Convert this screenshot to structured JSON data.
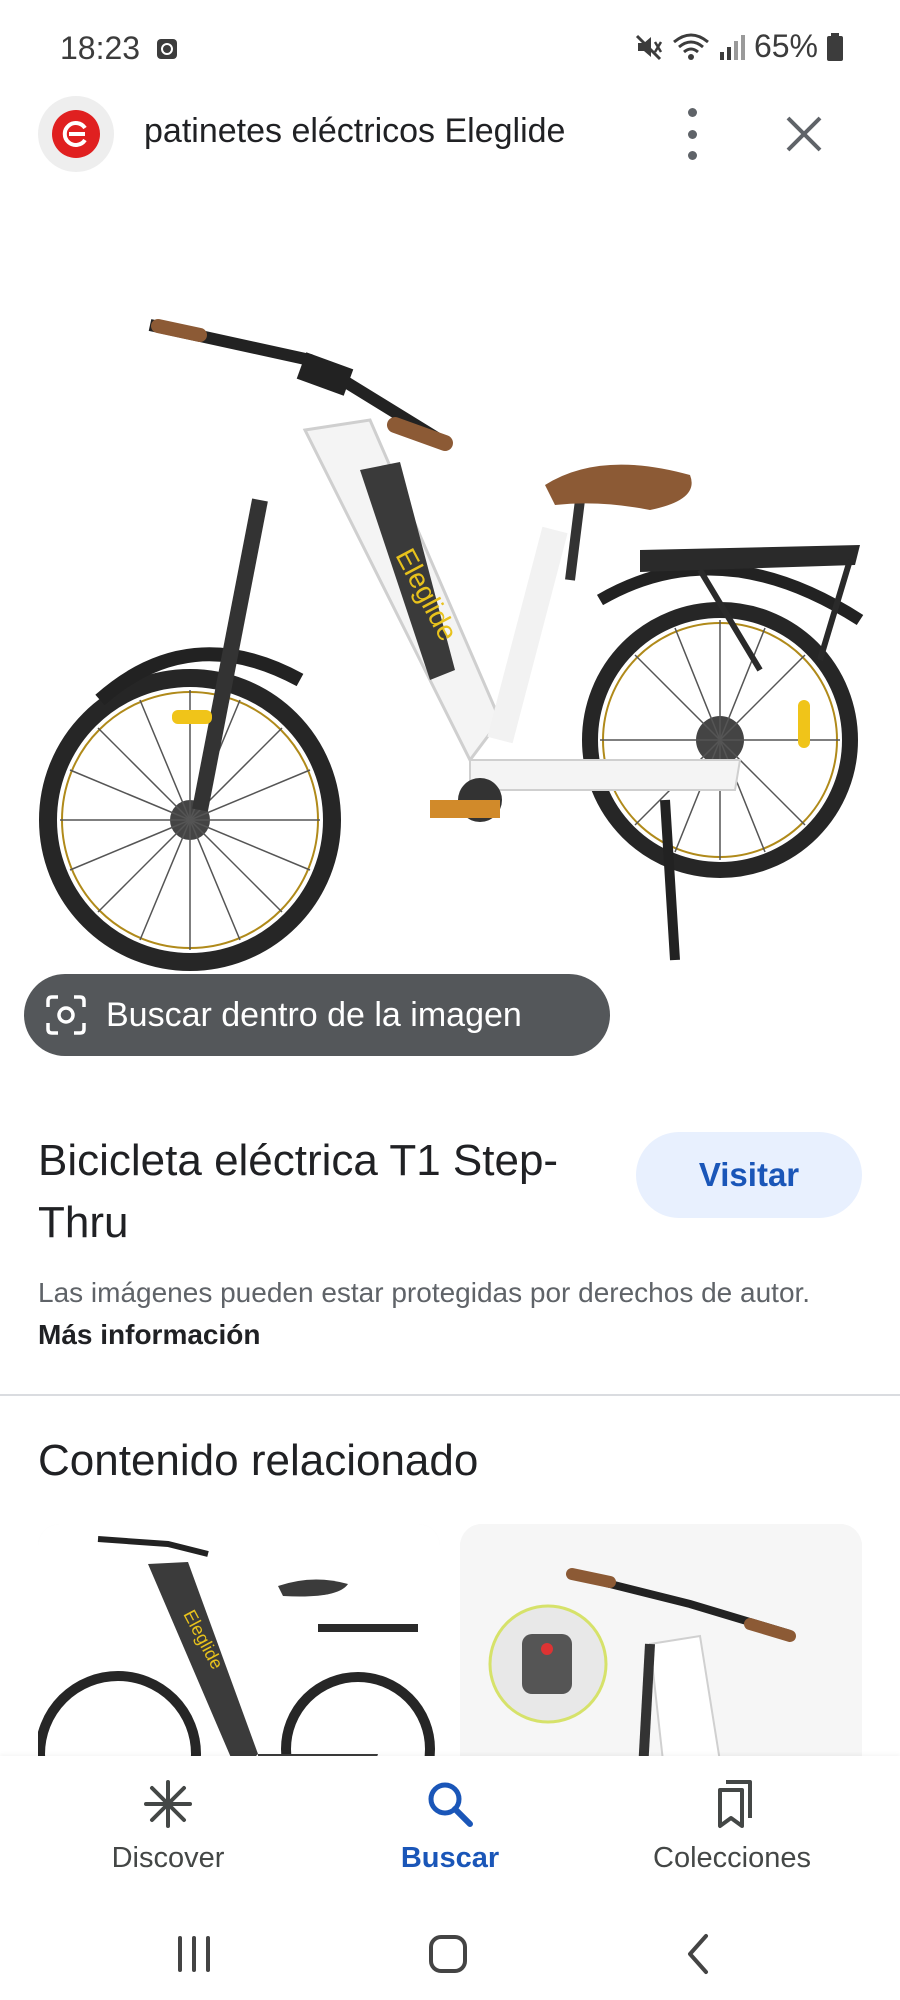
{
  "status_bar": {
    "time": "18:23",
    "battery": "65%",
    "icons": [
      "clock-alarm-icon",
      "mute-icon",
      "wifi-icon",
      "signal-icon",
      "battery-icon"
    ]
  },
  "header": {
    "site_icon": "eleglide-logo-icon",
    "title": "patinetes eléctricos Eleglide",
    "more_icon": "more-vert-icon",
    "close_icon": "close-icon"
  },
  "image": {
    "lens_button_label": "Buscar dentro de la imagen",
    "lens_icon": "lens-icon",
    "brand_text": "Eleglide"
  },
  "result": {
    "title": "Bicicleta eléctrica T1 Step-Thru",
    "visit_label": "Visitar",
    "copyright_text": "Las imágenes pueden estar protegidas por derechos de autor.",
    "more_info_label": "Más información"
  },
  "related": {
    "title": "Contenido relacionado"
  },
  "bottom_nav": {
    "items": [
      {
        "label": "Discover",
        "icon": "discover-asterisk-icon",
        "active": false
      },
      {
        "label": "Buscar",
        "icon": "search-icon",
        "active": true
      },
      {
        "label": "Colecciones",
        "icon": "collections-icon",
        "active": false
      }
    ]
  },
  "colors": {
    "accent": "#1a56b8",
    "accent_bg": "#e8f0fe",
    "logo_red": "#e02020"
  }
}
